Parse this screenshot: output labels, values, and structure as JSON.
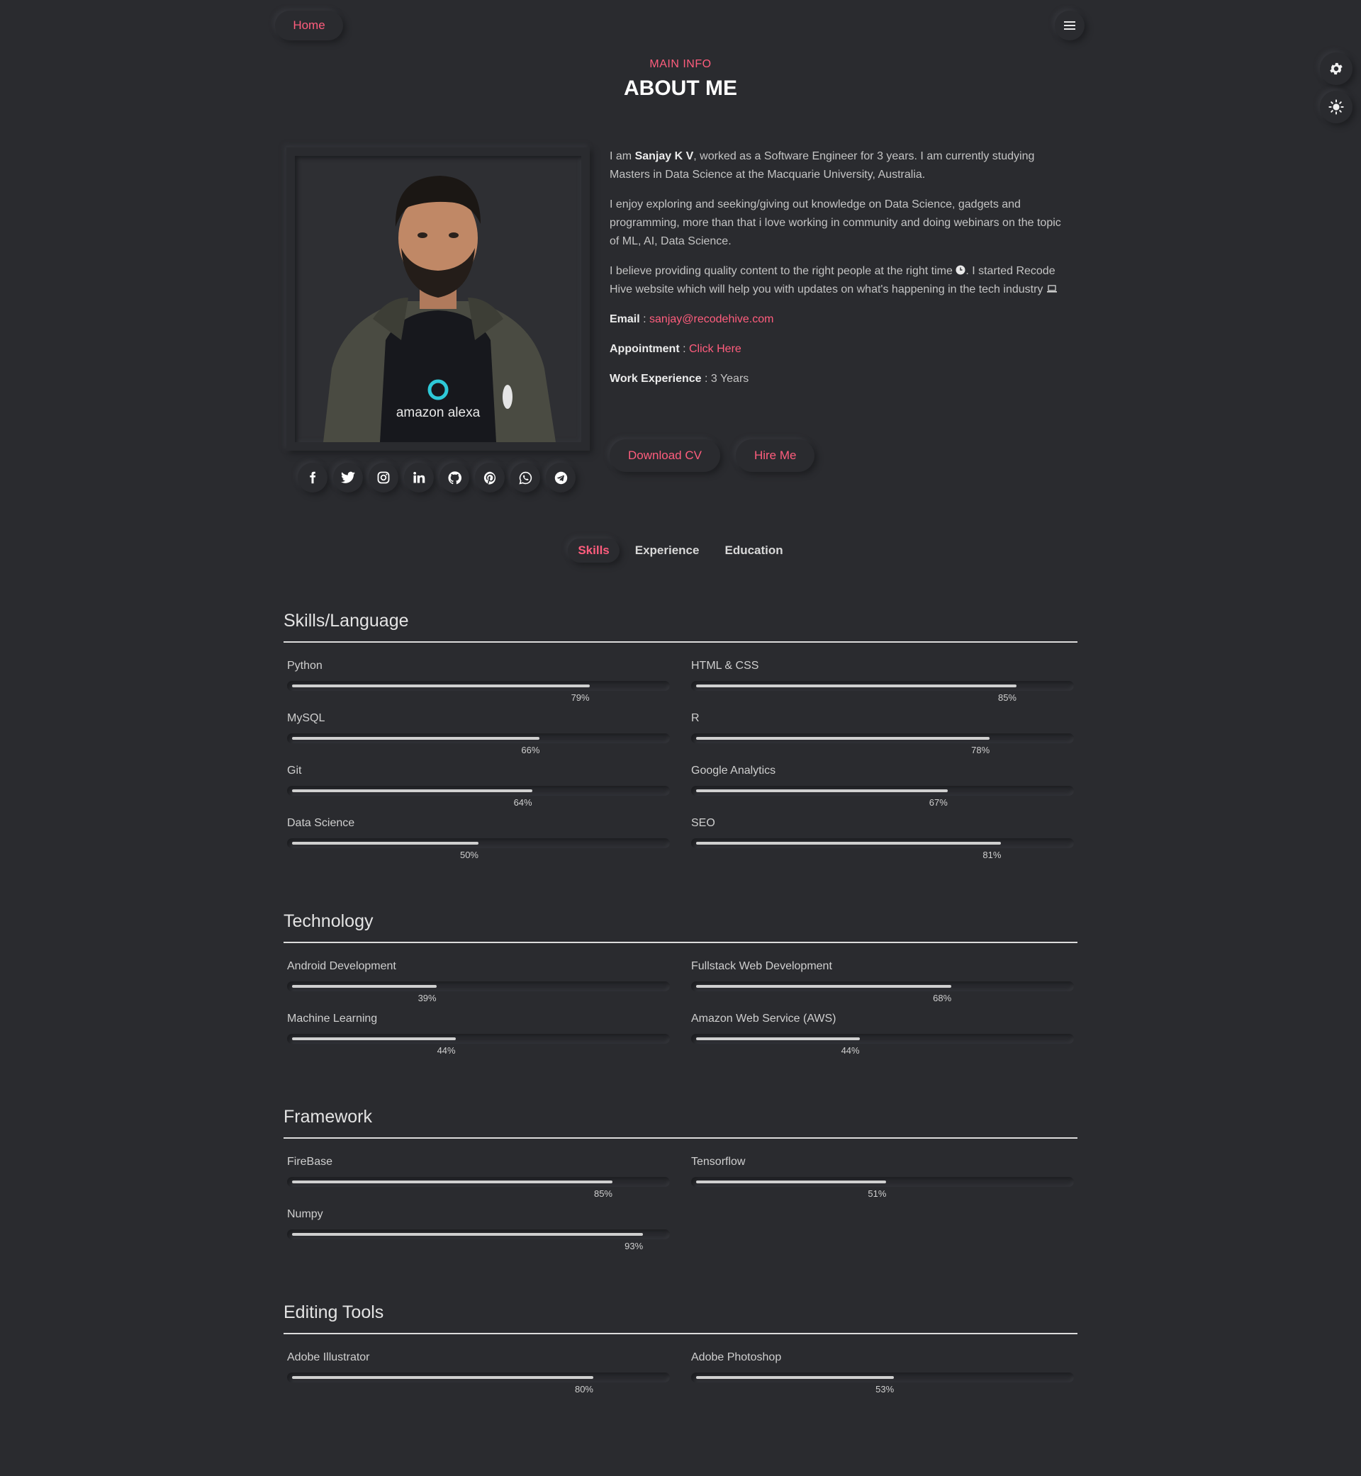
{
  "nav": {
    "home_label": "Home"
  },
  "header": {
    "subtitle": "MAIN INFO",
    "title": "ABOUT ME"
  },
  "photo": {
    "shirt_text": "amazon alexa"
  },
  "bio": {
    "p1_pre": "I am ",
    "p1_name": "Sanjay K V",
    "p1_post": ", worked as a Software Engineer for 3 years. I am currently studying Masters in Data Science at the Macquarie University, Australia.",
    "p2": "I enjoy exploring and seeking/giving out knowledge on Data Science, gadgets and programming, more than that i love working in community and doing webinars on the topic of ML, AI, Data Science.",
    "p3_pre": "I believe providing quality content to the right people at the right time",
    "p3_mid": ". I started Recode Hive website which will help you with updates on what's happening in the tech industry",
    "email_label": "Email",
    "email_value": "sanjay@recodehive.com",
    "appointment_label": "Appointment",
    "appointment_value": "Click Here",
    "experience_label": "Work Experience",
    "experience_value": "3 Years"
  },
  "buttons": {
    "download_cv": "Download CV",
    "hire_me": "Hire Me"
  },
  "social_icons": [
    "facebook-icon",
    "twitter-icon",
    "instagram-icon",
    "linkedin-icon",
    "github-icon",
    "pinterest-icon",
    "whatsapp-icon",
    "telegram-icon"
  ],
  "tabs": [
    {
      "label": "Skills",
      "active": true
    },
    {
      "label": "Experience",
      "active": false
    },
    {
      "label": "Education",
      "active": false
    }
  ],
  "sections": [
    {
      "title": "Skills/Language",
      "skills": [
        {
          "name": "Python",
          "percent": 79,
          "label": "79%"
        },
        {
          "name": "HTML & CSS",
          "percent": 85,
          "label": "85%"
        },
        {
          "name": "MySQL",
          "percent": 66,
          "label": "66%"
        },
        {
          "name": "R",
          "percent": 78,
          "label": "78%"
        },
        {
          "name": "Git",
          "percent": 64,
          "label": "64%"
        },
        {
          "name": "Google Analytics",
          "percent": 67,
          "label": "67%"
        },
        {
          "name": "Data Science",
          "percent": 50,
          "label": "50%"
        },
        {
          "name": "SEO",
          "percent": 81,
          "label": "81%"
        }
      ]
    },
    {
      "title": "Technology",
      "skills": [
        {
          "name": "Android Development",
          "percent": 39,
          "label": "39%"
        },
        {
          "name": "Fullstack Web Development",
          "percent": 68,
          "label": "68%"
        },
        {
          "name": "Machine Learning",
          "percent": 44,
          "label": "44%"
        },
        {
          "name": "Amazon Web Service (AWS)",
          "percent": 44,
          "label": "44%"
        }
      ]
    },
    {
      "title": "Framework",
      "skills": [
        {
          "name": "FireBase",
          "percent": 85,
          "label": "85%"
        },
        {
          "name": "Tensorflow",
          "percent": 51,
          "label": "51%"
        },
        {
          "name": "Numpy",
          "percent": 93,
          "label": "93%"
        }
      ]
    },
    {
      "title": "Editing Tools",
      "skills": [
        {
          "name": "Adobe Illustrator",
          "percent": 80,
          "label": "80%"
        },
        {
          "name": "Adobe Photoshop",
          "percent": 53,
          "label": "53%"
        }
      ]
    }
  ],
  "colors": {
    "accent": "#ff5d7d",
    "background": "#2a2b2f",
    "bar": "#d0d0d0"
  }
}
